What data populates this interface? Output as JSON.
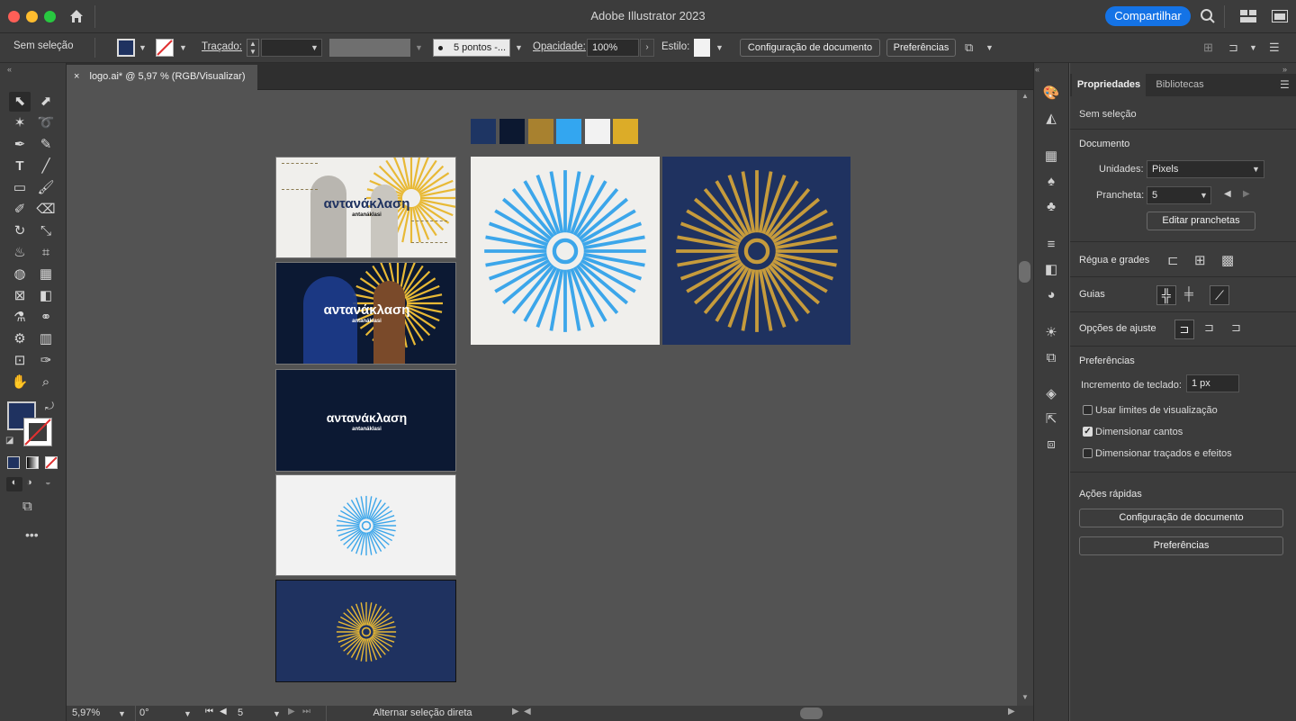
{
  "app": {
    "title": "Adobe Illustrator 2023",
    "share_label": "Compartilhar"
  },
  "control_bar": {
    "selection": "Sem seleção",
    "stroke_label": "Traçado:",
    "brush_label": "5 pontos -...",
    "opacity_label": "Opacidade:",
    "opacity_value": "100%",
    "style_label": "Estilo:",
    "doc_setup": "Configuração de documento",
    "prefs": "Preferências"
  },
  "document_tab": {
    "label": "logo.ai* @ 5,97 % (RGB/Visualizar)",
    "close": "×"
  },
  "swatches": [
    "#1e3563",
    "#0c1830",
    "#a8812f",
    "#33a6f0",
    "#f2f2f2",
    "#dcac28"
  ],
  "artboards": {
    "greek_title": "αντανάκλαση",
    "latin_title": "antanáklasi",
    "colors": {
      "blue_ray": "#3ca6ea",
      "gold_ray": "#c69b3c",
      "yellow_ray": "#e8b935",
      "navy": "#1f3260",
      "dark_navy": "#0c1933",
      "paper": "#f0efec"
    }
  },
  "status": {
    "zoom": "5,97%",
    "rotation": "0°",
    "artboard": "5",
    "tool_hint": "Alternar seleção direta"
  },
  "panel": {
    "tab_properties": "Propriedades",
    "tab_libraries": "Bibliotecas",
    "no_selection": "Sem seleção",
    "document": {
      "section": "Documento",
      "units_label": "Unidades:",
      "units_value": "Pixels",
      "artboard_label": "Prancheta:",
      "artboard_value": "5",
      "edit_artboards": "Editar pranchetas"
    },
    "rulers_grids": "Régua e grades",
    "guides": "Guias",
    "snap_options": "Opções de ajuste",
    "preferences": {
      "section": "Preferências",
      "keyboard_increment_label": "Incremento de teclado:",
      "keyboard_increment_value": "1 px",
      "use_preview_bounds": "Usar limites de visualização",
      "scale_corners": "Dimensionar cantos",
      "scale_strokes": "Dimensionar traçados e efeitos",
      "use_preview_bounds_checked": false,
      "scale_corners_checked": true,
      "scale_strokes_checked": false
    },
    "quick_actions": {
      "section": "Ações rápidas",
      "doc_setup": "Configuração de documento",
      "prefs": "Preferências"
    }
  }
}
